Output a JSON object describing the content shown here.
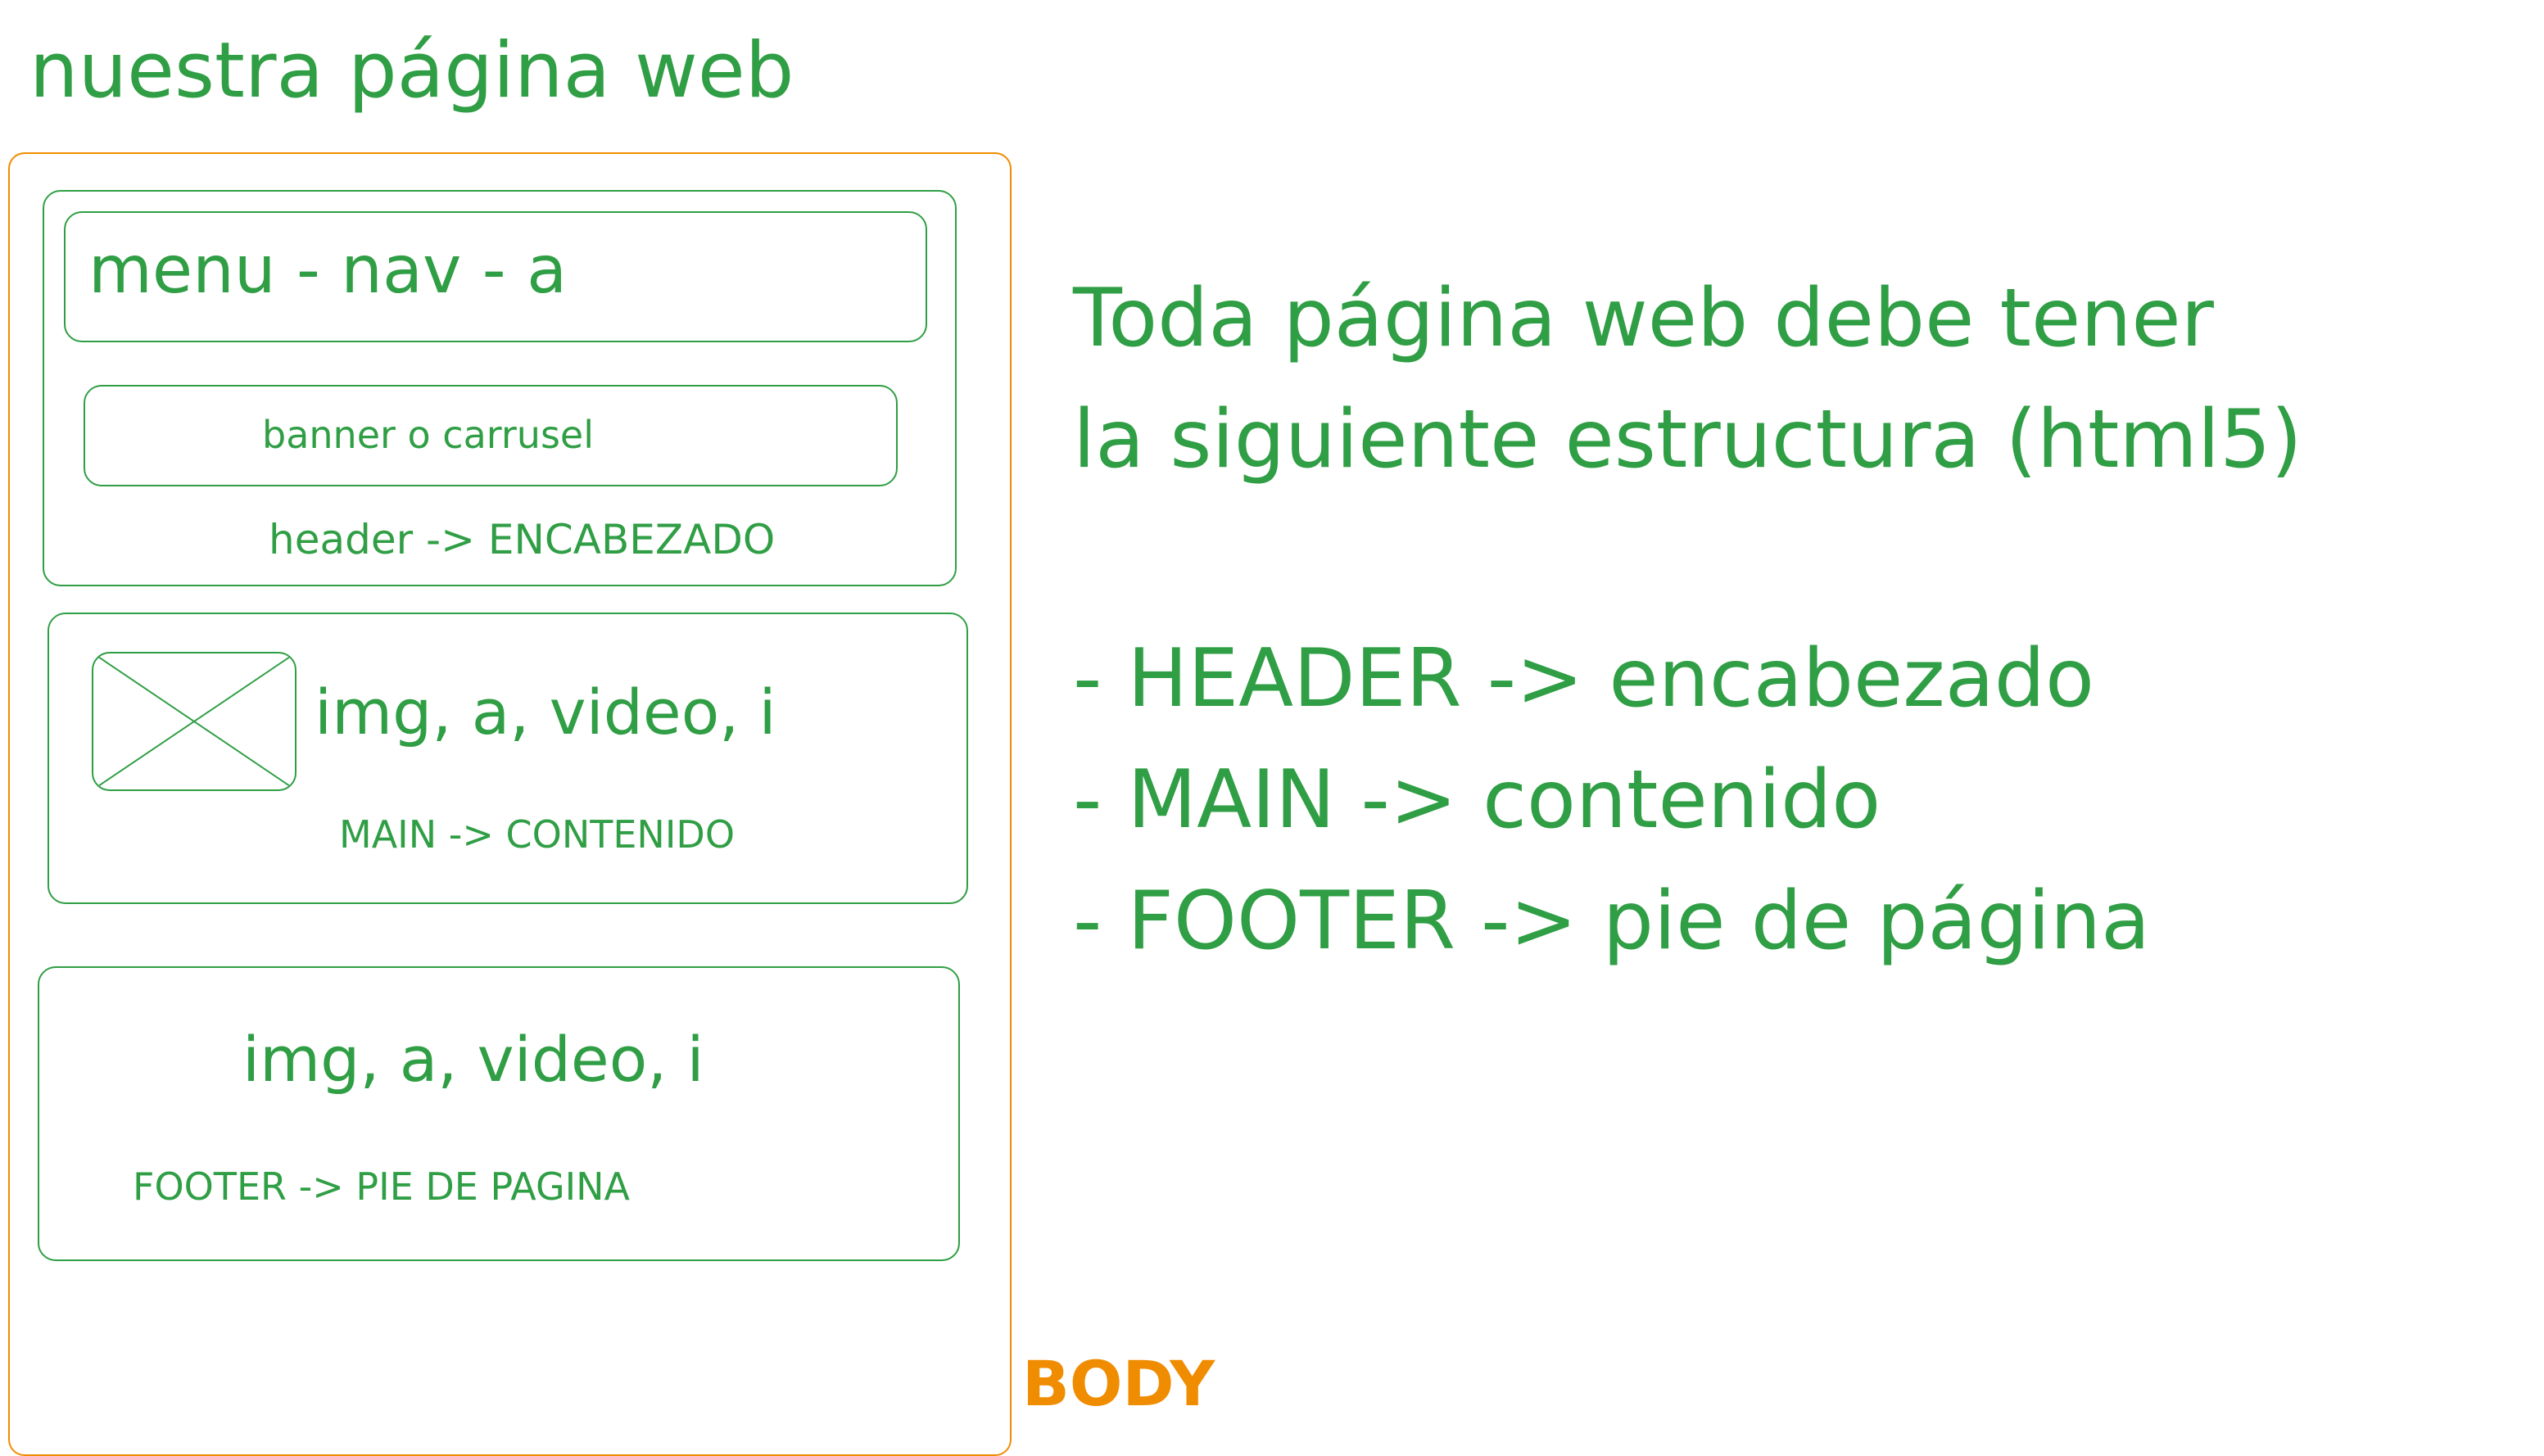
{
  "title": "nuestra página web",
  "body_label": "BODY",
  "colors": {
    "green": "#2f9e44",
    "orange": "#f08c00"
  },
  "header": {
    "nav": "menu - nav - a",
    "banner": "banner o carrusel",
    "label": "header -> ENCABEZADO"
  },
  "main": {
    "image_icon": "image-placeholder-icon",
    "elements": "img, a, video, i",
    "label": "MAIN -> CONTENIDO"
  },
  "footer": {
    "elements": "img, a, video, i",
    "label": "FOOTER -> PIE DE PAGINA"
  },
  "explanation": {
    "intro_line_1": "Toda página web debe tener",
    "intro_line_2": "la siguiente estructura (html5)",
    "items": [
      "- HEADER -> encabezado",
      "- MAIN -> contenido",
      "- FOOTER -> pie de página"
    ]
  }
}
